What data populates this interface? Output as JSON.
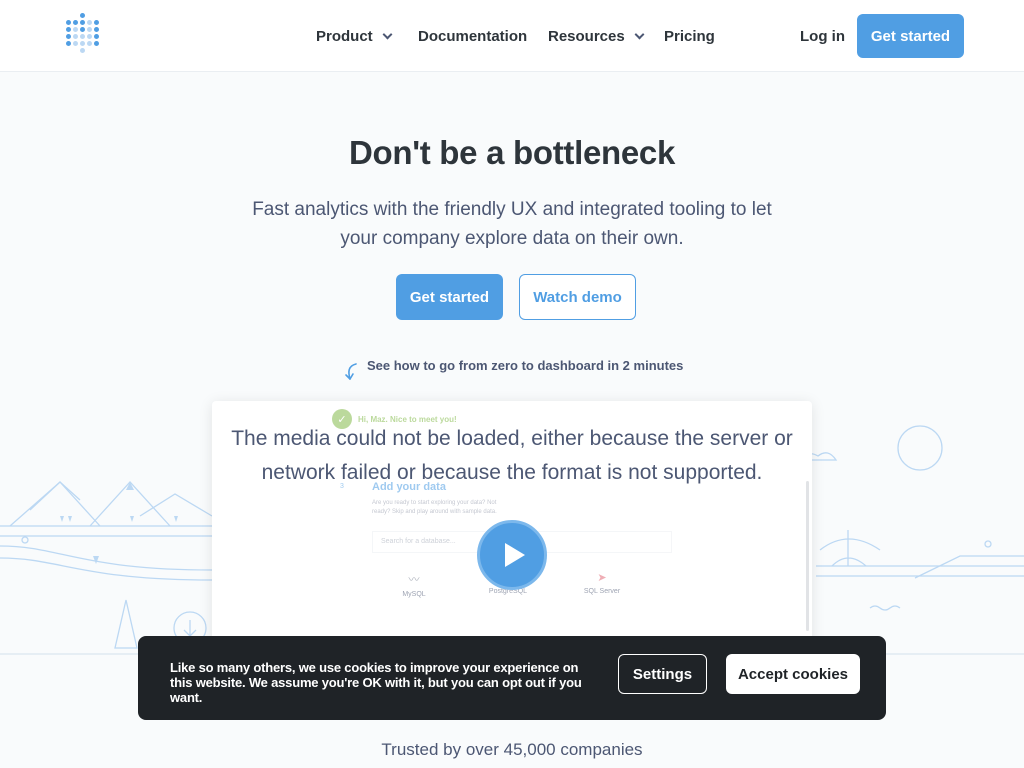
{
  "nav": {
    "links": [
      {
        "label": "Product",
        "has_dropdown": true
      },
      {
        "label": "Documentation",
        "has_dropdown": false
      },
      {
        "label": "Resources",
        "has_dropdown": true
      },
      {
        "label": "Pricing",
        "has_dropdown": false
      }
    ],
    "login": "Log in",
    "cta": "Get started"
  },
  "hero": {
    "title": "Don't be a bottleneck",
    "subtitle": "Fast analytics with the friendly UX and integrated tooling to let your company explore data on their own.",
    "primary_button": "Get started",
    "secondary_button": "Watch demo",
    "hint": "See how to go from zero to dashboard in 2 minutes"
  },
  "video": {
    "greeting": "Hi, Maz. Nice to meet you!",
    "step_number": "3",
    "add_data_title": "Add your data",
    "add_data_sub": "Are you ready to start exploring your data? Not ready? Skip and play around with sample data.",
    "search_placeholder": "Search for a database...",
    "databases": [
      "MySQL",
      "PostgreSQL",
      "SQL Server"
    ],
    "error_message": "The media could not be loaded, either because the server or network failed or because the format is not supported."
  },
  "cookie": {
    "text": "Like so many others, we use cookies to improve your experience on this website. We assume you're OK with it, but you can opt out if you want.",
    "settings": "Settings",
    "accept": "Accept cookies"
  },
  "trusted": "Trusted by over 45,000 companies",
  "colors": {
    "brand_blue": "#509ee3",
    "text_dark": "#2e353b",
    "text_muted": "#4c5773",
    "cookie_bg": "#1f2327",
    "success_green": "#84bb4c"
  },
  "icons": [
    "metabase-logo-icon",
    "chevron-down-icon",
    "curved-arrow-icon",
    "check-icon",
    "play-icon"
  ]
}
